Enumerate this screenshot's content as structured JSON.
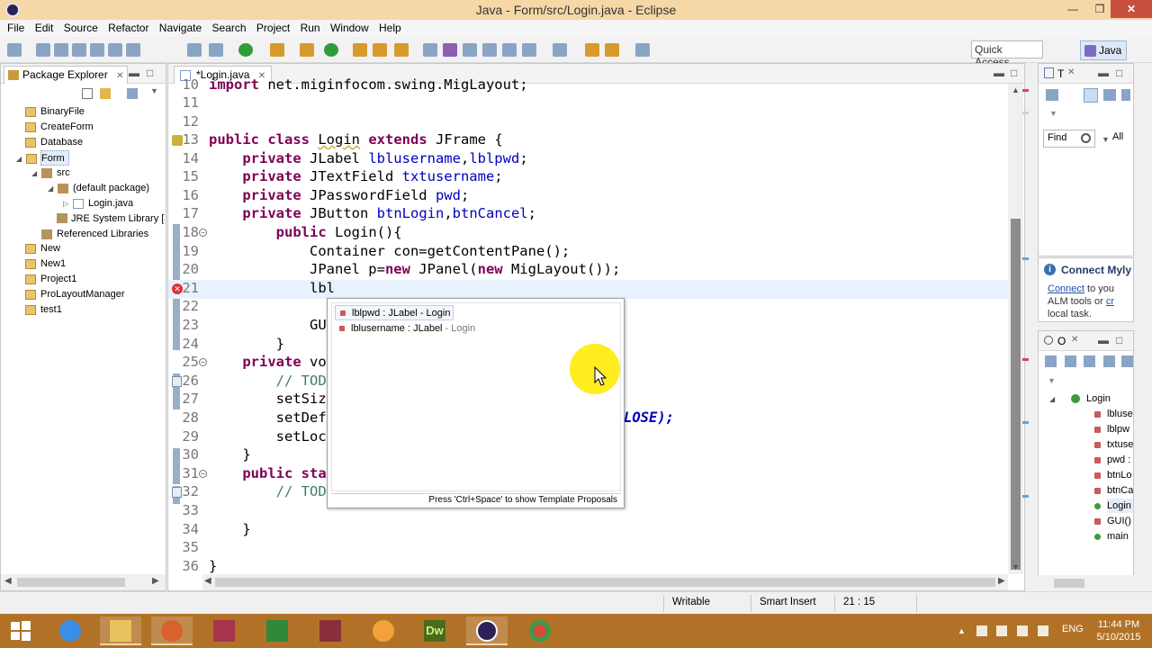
{
  "window": {
    "title": "Java - Form/src/Login.java - Eclipse",
    "minimize": "—",
    "maximize": "❐",
    "close": "✕"
  },
  "menu": [
    "File",
    "Edit",
    "Source",
    "Refactor",
    "Navigate",
    "Search",
    "Project",
    "Run",
    "Window",
    "Help"
  ],
  "toolbar": {
    "quick_access": "Quick Access",
    "perspective": "Java"
  },
  "package_explorer": {
    "title": "Package Explorer",
    "close": "✕",
    "items": [
      {
        "label": "BinaryFile"
      },
      {
        "label": "CreateForm"
      },
      {
        "label": "Database"
      },
      {
        "label": "Form"
      },
      {
        "label": "src"
      },
      {
        "label": "(default package)"
      },
      {
        "label": "Login.java"
      },
      {
        "label": "JRE System Library [Java"
      },
      {
        "label": "Referenced Libraries"
      },
      {
        "label": "New"
      },
      {
        "label": "New1"
      },
      {
        "label": "Project1"
      },
      {
        "label": "ProLayoutManager"
      },
      {
        "label": "test1"
      }
    ]
  },
  "editor": {
    "tab_label": "*Login.java",
    "tab_close": "✕",
    "lines": [
      {
        "n": "10",
        "text": "import net.miginfocom.swing.MigLayout;"
      },
      {
        "n": "11",
        "text": ""
      },
      {
        "n": "12",
        "text": ""
      },
      {
        "n": "13",
        "text": "public class Login extends JFrame {"
      },
      {
        "n": "14",
        "text": "    private JLabel lblusername,lblpwd;"
      },
      {
        "n": "15",
        "text": "    private JTextField txtusername;"
      },
      {
        "n": "16",
        "text": "    private JPasswordField pwd;"
      },
      {
        "n": "17",
        "text": "    private JButton btnLogin,btnCancel;"
      },
      {
        "n": "18",
        "text": "        public Login(){"
      },
      {
        "n": "19",
        "text": "            Container con=getContentPane();"
      },
      {
        "n": "20",
        "text": "            JPanel p=new JPanel(new MigLayout());"
      },
      {
        "n": "21",
        "text": "            lbl"
      },
      {
        "n": "22",
        "text": ""
      },
      {
        "n": "23",
        "text": "            GUI"
      },
      {
        "n": "24",
        "text": "        }"
      },
      {
        "n": "25",
        "text": "    private vo"
      },
      {
        "n": "26",
        "text": "        // TOD"
      },
      {
        "n": "27",
        "text": "        setSiz"
      },
      {
        "n": "28",
        "text": "        setDef"
      },
      {
        "n": "29",
        "text": "        setLoc"
      },
      {
        "n": "30",
        "text": "    }"
      },
      {
        "n": "31",
        "text": "    public sta"
      },
      {
        "n": "32",
        "text": "        // TOD"
      },
      {
        "n": "33",
        "text": ""
      },
      {
        "n": "34",
        "text": "    }"
      },
      {
        "n": "35",
        "text": ""
      },
      {
        "n": "36",
        "text": "}"
      }
    ],
    "line28_tail": "LOSE);"
  },
  "content_assist": {
    "proposals": [
      {
        "name": "lblpwd : JLabel - Login"
      },
      {
        "name": "lblusername : JLabel",
        "owner": " - Login"
      }
    ],
    "footer": "Press 'Ctrl+Space' to show Template Proposals"
  },
  "task_list": {
    "tab": "T",
    "find_placeholder": "Find",
    "all_label": "All"
  },
  "mylyn": {
    "title": "Connect Myly",
    "link": "Connect",
    "text_after_link": " to you",
    "line2": "ALM tools or ",
    "line2_link": "cr",
    "line3": "local task."
  },
  "outline": {
    "tab": "O",
    "class_name": "Login",
    "members": [
      "lbluse",
      "lblpw",
      "txtuse",
      "pwd :",
      "btnLo",
      "btnCa",
      "Login",
      "GUI()",
      "main"
    ]
  },
  "status_bar": {
    "writable": "Writable",
    "insert_mode": "Smart Insert",
    "position": "21 : 15"
  },
  "taskbar": {
    "ime": "ENG",
    "time": "11:44 PM",
    "date": "5/10/2015"
  },
  "colors": {
    "title_bar": "#f6d7a6",
    "taskbar": "#b17228",
    "keyword": "#7f0055",
    "field": "#0000c0",
    "comment": "#3f7f5f",
    "cursor_highlight": "#ffeb00"
  }
}
